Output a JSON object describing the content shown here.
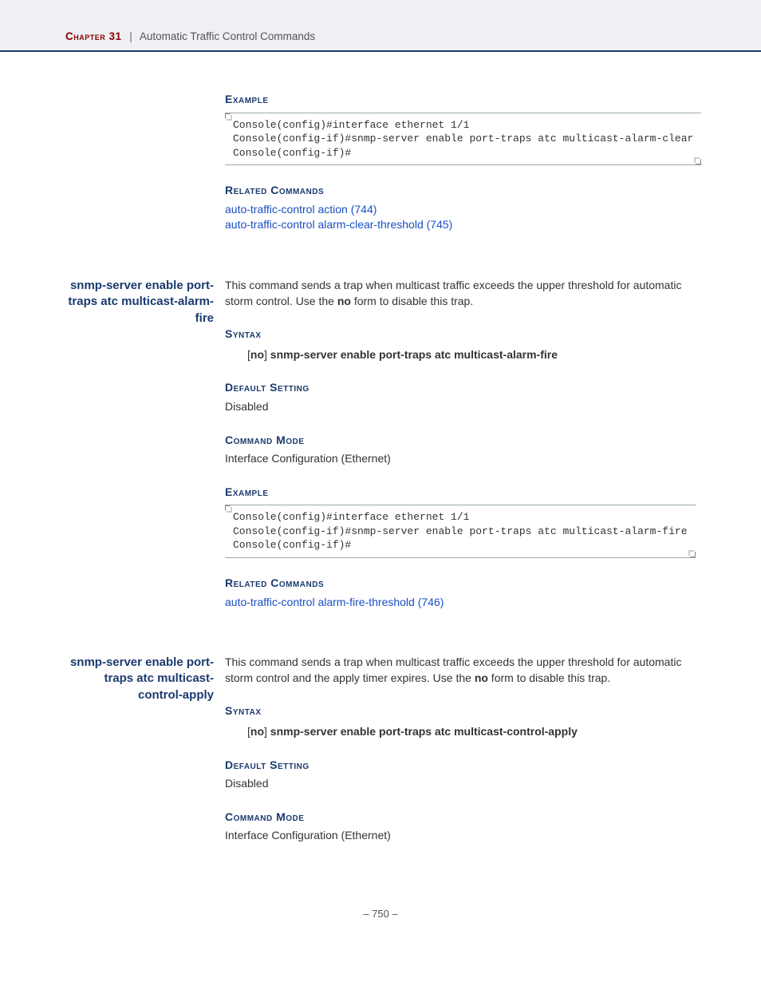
{
  "header": {
    "chapter_label": "Chapter 31",
    "separator": "|",
    "title": "Automatic Traffic Control Commands"
  },
  "section1": {
    "heading_example": "Example",
    "code": "Console(config)#interface ethernet 1/1\nConsole(config-if)#snmp-server enable port-traps atc multicast-alarm-clear\nConsole(config-if)#",
    "heading_related": "Related Commands",
    "links": [
      "auto-traffic-control action (744)",
      "auto-traffic-control alarm-clear-threshold (745)"
    ]
  },
  "section2": {
    "side_title": "snmp-server enable port-traps atc multicast-alarm-fire",
    "desc_pre": "This command sends a trap when multicast traffic exceeds the upper threshold for automatic storm control. Use the ",
    "desc_bold": "no",
    "desc_post": " form to disable this trap.",
    "heading_syntax": "Syntax",
    "syntax_bracket_open": "[",
    "syntax_no": "no",
    "syntax_bracket_close": "]",
    "syntax_cmd": " snmp-server enable port-traps atc multicast-alarm-fire",
    "heading_default": "Default Setting",
    "default_val": "Disabled",
    "heading_mode": "Command Mode",
    "mode_val": "Interface Configuration (Ethernet)",
    "heading_example": "Example",
    "code": "Console(config)#interface ethernet 1/1\nConsole(config-if)#snmp-server enable port-traps atc multicast-alarm-fire\nConsole(config-if)#",
    "heading_related": "Related Commands",
    "links": [
      "auto-traffic-control alarm-fire-threshold (746)"
    ]
  },
  "section3": {
    "side_title": "snmp-server enable port-traps atc multicast-control-apply",
    "desc_pre": "This command sends a trap when multicast traffic exceeds the upper threshold for automatic storm control and the apply timer expires. Use the ",
    "desc_bold": "no",
    "desc_post": " form to disable this trap.",
    "heading_syntax": "Syntax",
    "syntax_bracket_open": "[",
    "syntax_no": "no",
    "syntax_bracket_close": "]",
    "syntax_cmd": " snmp-server enable port-traps atc multicast-control-apply",
    "heading_default": "Default Setting",
    "default_val": "Disabled",
    "heading_mode": "Command Mode",
    "mode_val": "Interface Configuration (Ethernet)"
  },
  "footer": {
    "page": "–  750  –"
  }
}
